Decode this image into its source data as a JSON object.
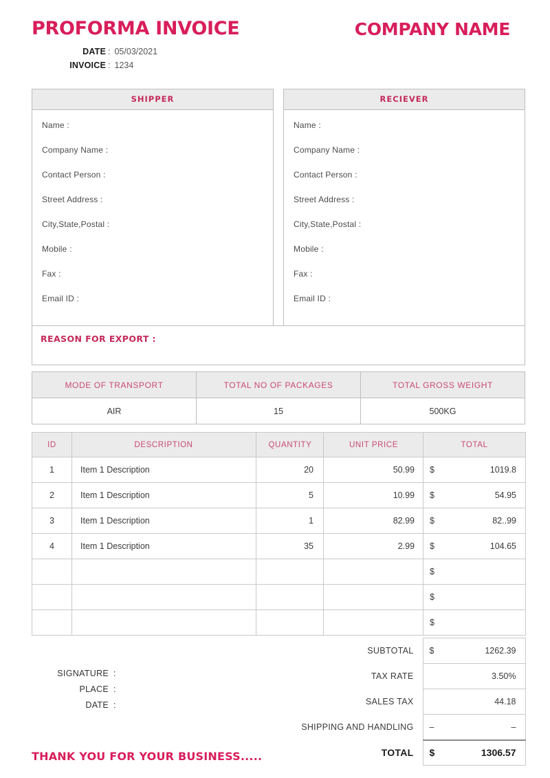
{
  "header": {
    "doc_title": "PROFORMA INVOICE",
    "company_name": "COMPANY NAME",
    "date_label": "DATE",
    "date_value": "05/03/2021",
    "invoice_label": "INVOICE",
    "invoice_value": "1234",
    "colon": ":"
  },
  "accent_color": "#d81e5b",
  "shipper": {
    "heading": "SHIPPER",
    "fields": [
      "Name :",
      "Company Name :",
      "Contact Person :",
      "Street Address :",
      "City,State,Postal :",
      "Mobile :",
      "Fax :",
      "Email ID :"
    ]
  },
  "receiver": {
    "heading": "RECIEVER",
    "fields": [
      "Name :",
      "Company Name :",
      "Contact Person :",
      "Street Address :",
      "City,State,Postal :",
      "Mobile :",
      "Fax :",
      "Email ID :"
    ]
  },
  "reason_for_export": {
    "label": "REASON FOR EXPORT :",
    "value": ""
  },
  "transport": {
    "headers": [
      "MODE OF TRANSPORT",
      "TOTAL NO OF PACKAGES",
      "TOTAL GROSS WEIGHT"
    ],
    "values": [
      "AIR",
      "15",
      "500KG"
    ]
  },
  "items": {
    "headers": [
      "ID",
      "DESCRIPTION",
      "QUANTITY",
      "UNIT PRICE",
      "TOTAL"
    ],
    "currency": "$",
    "rows": [
      {
        "id": "1",
        "description": "Item 1 Description",
        "quantity": "20",
        "unit_price": "50.99",
        "currency": "$",
        "total": "1019.8"
      },
      {
        "id": "2",
        "description": "Item 1 Description",
        "quantity": "5",
        "unit_price": "10.99",
        "currency": "$",
        "total": "54.95"
      },
      {
        "id": "3",
        "description": "Item 1 Description",
        "quantity": "1",
        "unit_price": "82.99",
        "currency": "$",
        "total": "82..99"
      },
      {
        "id": "4",
        "description": "Item 1 Description",
        "quantity": "35",
        "unit_price": "2.99",
        "currency": "$",
        "total": "104.65"
      },
      {
        "id": "",
        "description": "",
        "quantity": "",
        "unit_price": "",
        "currency": "$",
        "total": ""
      },
      {
        "id": "",
        "description": "",
        "quantity": "",
        "unit_price": "",
        "currency": "$",
        "total": ""
      },
      {
        "id": "",
        "description": "",
        "quantity": "",
        "unit_price": "",
        "currency": "$",
        "total": ""
      }
    ]
  },
  "totals": {
    "subtotal_label": "SUBTOTAL",
    "subtotal_currency": "$",
    "subtotal_value": "1262.39",
    "tax_rate_label": "TAX RATE",
    "tax_rate_currency": "",
    "tax_rate_value": "3.50%",
    "sales_tax_label": "SALES TAX",
    "sales_tax_currency": "",
    "sales_tax_value": "44.18",
    "shipping_label": "SHIPPING AND HANDLING",
    "shipping_currency": "–",
    "shipping_value": "–",
    "total_label": "TOTAL",
    "total_currency": "$",
    "total_value": "1306.57"
  },
  "signature": {
    "rows": [
      {
        "label": "SIGNATURE",
        "colon": ":"
      },
      {
        "label": "PLACE",
        "colon": ":"
      },
      {
        "label": "DATE",
        "colon": ":"
      }
    ]
  },
  "footer": {
    "thanks": "THANK YOU FOR YOUR BUSINESS....."
  }
}
